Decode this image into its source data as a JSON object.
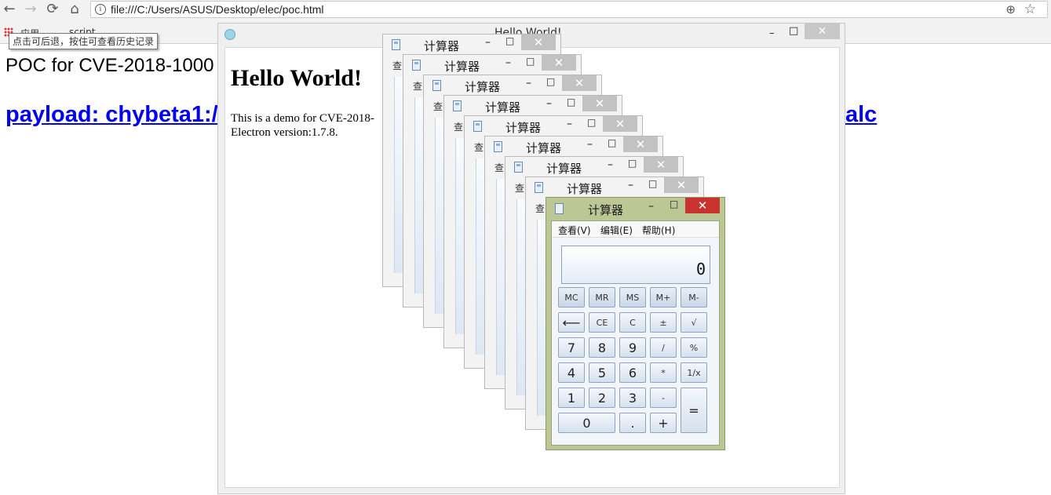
{
  "browser": {
    "back": "←",
    "forward": "→",
    "reload": "⟳",
    "home": "⌂",
    "url": "file:///C:/Users/ASUS/Desktop/elec/poc.html",
    "bookmarks": [
      "应用",
      "script"
    ],
    "tooltip": "点击可后退，按住可查看历史记录"
  },
  "page": {
    "heading": "POC for CVE-2018-1000",
    "payload_visible_left": "payload: chybeta1:/",
    "payload_visible_right": "alc"
  },
  "electron": {
    "title": "Hello World!",
    "min": "–",
    "max": "□",
    "close": "✕",
    "heading": "Hello World!",
    "line1": "This is a demo for CVE-2018-",
    "line2": "Electron version:1.7.8."
  },
  "calculator": {
    "title": "计算器",
    "min": "–",
    "max": "□",
    "close": "✕",
    "menu_partial": "查",
    "menu": [
      "查看(V)",
      "编辑(E)",
      "帮助(H)"
    ],
    "display": "0",
    "keys": {
      "mc": "MC",
      "mr": "MR",
      "ms": "MS",
      "mplus": "M+",
      "mminus": "M-",
      "back": "⟵",
      "ce": "CE",
      "c": "C",
      "pm": "±",
      "sqrt": "√",
      "k7": "7",
      "k8": "8",
      "k9": "9",
      "div": "/",
      "pct": "%",
      "k4": "4",
      "k5": "5",
      "k6": "6",
      "mul": "*",
      "inv": "1/x",
      "k1": "1",
      "k2": "2",
      "k3": "3",
      "sub": "-",
      "eq": "=",
      "k0": "0",
      "dot": ".",
      "add": "+"
    }
  },
  "colors": {
    "active_frame": "#bdc796",
    "close_active": "#c8322f",
    "link": "#0000ee"
  }
}
